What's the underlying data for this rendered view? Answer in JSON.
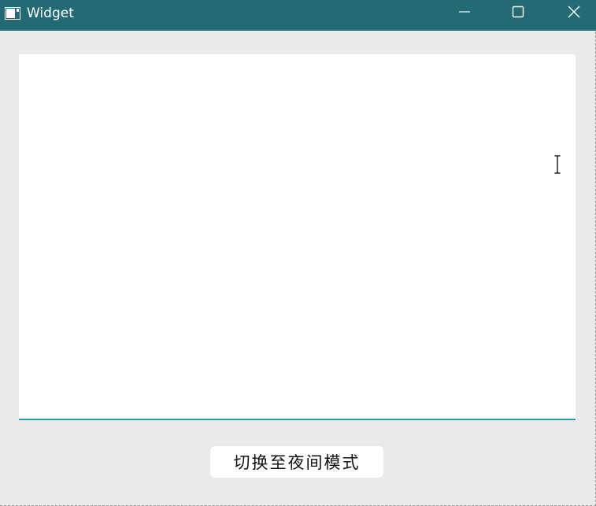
{
  "window": {
    "title": "Widget",
    "colors": {
      "titlebar": "#226b74",
      "background": "#ebe9ea",
      "accent": "#2c9fa4"
    }
  },
  "controls": {
    "minimize_icon": "minimize-icon",
    "maximize_icon": "maximize-icon",
    "close_icon": "close-icon"
  },
  "editor": {
    "content": "",
    "cursor_icon": "text-cursor-icon"
  },
  "toolbar": {
    "mode_button_label": "切换至夜间模式"
  }
}
